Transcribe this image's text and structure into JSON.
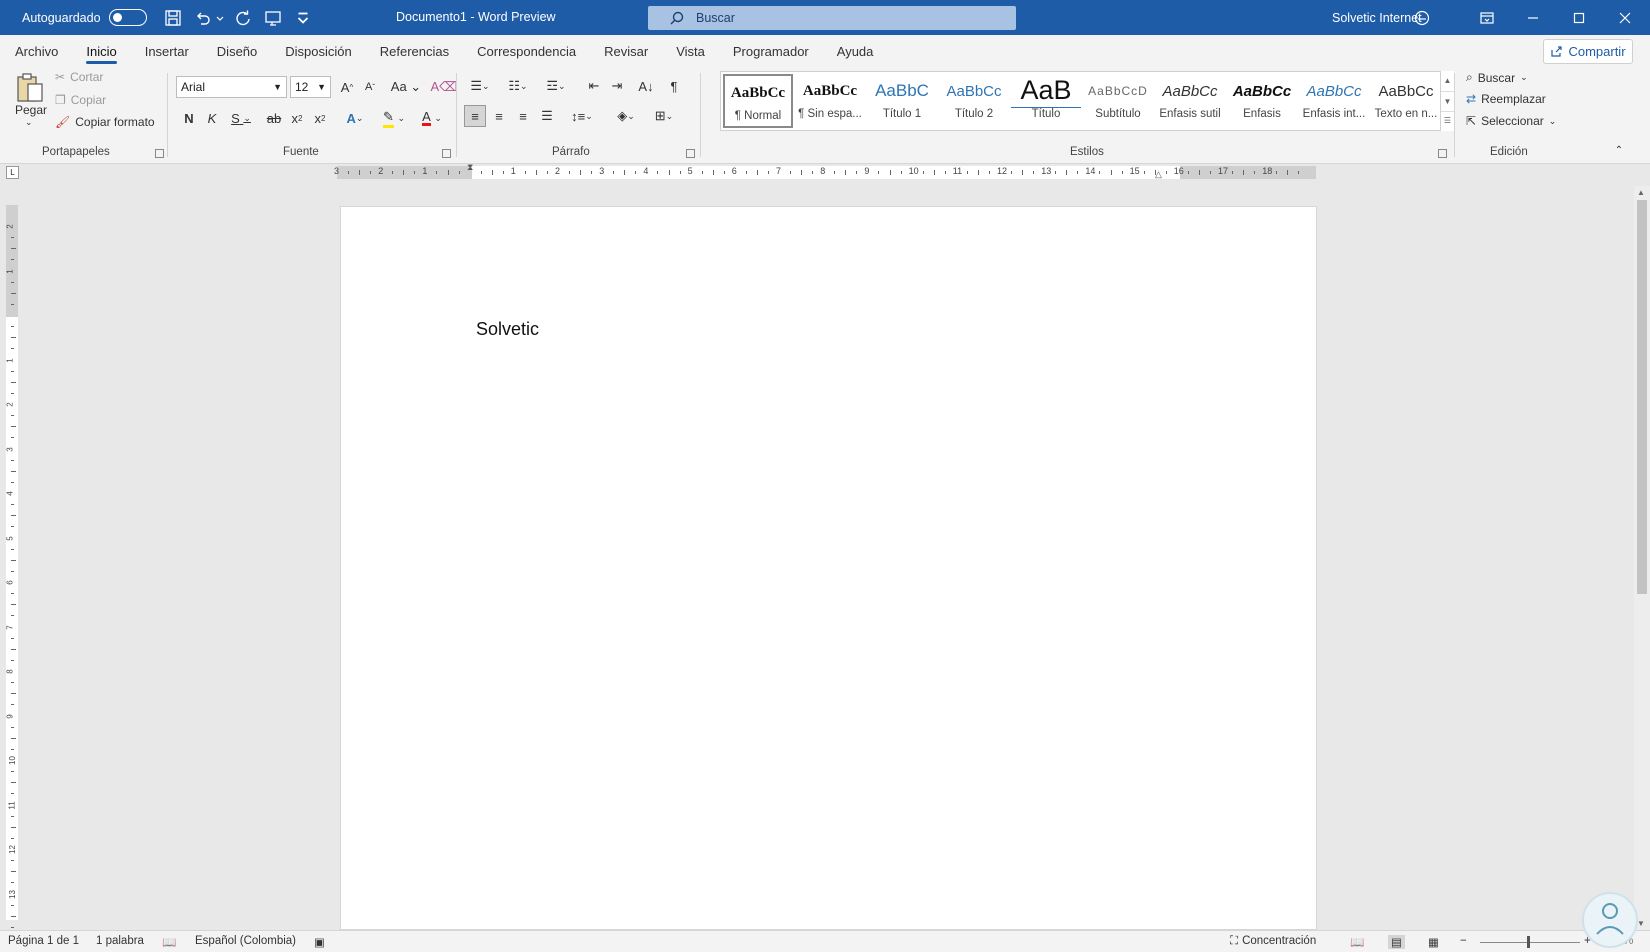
{
  "titlebar": {
    "autosave_label": "Autoguardado",
    "doc_title": "Documento1 - Word Preview",
    "search_placeholder": "Buscar",
    "user_name": "Solvetic Internet"
  },
  "menu": {
    "tabs": [
      "Archivo",
      "Inicio",
      "Insertar",
      "Diseño",
      "Disposición",
      "Referencias",
      "Correspondencia",
      "Revisar",
      "Vista",
      "Programador",
      "Ayuda"
    ],
    "active_tab": "Inicio",
    "share_label": "Compartir"
  },
  "ribbon": {
    "clipboard": {
      "paste": "Pegar",
      "cut": "Cortar",
      "copy": "Copiar",
      "format_painter": "Copiar formato",
      "label": "Portapapeles"
    },
    "font": {
      "name": "Arial",
      "size": "12",
      "bold": "N",
      "italic": "K",
      "underline": "S",
      "label": "Fuente"
    },
    "paragraph": {
      "label": "Párrafo"
    },
    "styles": {
      "label": "Estilos",
      "items": [
        {
          "sample": "AaBbCc",
          "name": "¶ Normal"
        },
        {
          "sample": "AaBbCc",
          "name": "¶ Sin espa..."
        },
        {
          "sample": "AaBbC",
          "name": "Título 1"
        },
        {
          "sample": "AaBbCc",
          "name": "Título 2"
        },
        {
          "sample": "AaB",
          "name": "Título"
        },
        {
          "sample": "AaBbCcD",
          "name": "Subtítulo"
        },
        {
          "sample": "AaBbCc",
          "name": "Énfasis sutil"
        },
        {
          "sample": "AaBbCc",
          "name": "Énfasis"
        },
        {
          "sample": "AaBbCc",
          "name": "Énfasis int..."
        },
        {
          "sample": "AaBbCc",
          "name": "Texto en n..."
        }
      ]
    },
    "editing": {
      "find": "Buscar",
      "replace": "Reemplazar",
      "select": "Seleccionar",
      "label": "Edición"
    }
  },
  "ruler": {
    "numbers": [
      "3",
      "2",
      "1",
      "",
      "1",
      "2",
      "3",
      "4",
      "5",
      "6",
      "7",
      "8",
      "9",
      "10",
      "11",
      "12",
      "13",
      "14",
      "15",
      "16",
      "17",
      "18"
    ]
  },
  "vruler": {
    "numbers": [
      "2",
      "1",
      "",
      "1",
      "2",
      "3",
      "4",
      "5",
      "6",
      "7",
      "8",
      "9",
      "10",
      "11",
      "12",
      "13"
    ]
  },
  "document": {
    "text": "Solvetic"
  },
  "status": {
    "page": "Página 1 de 1",
    "words": "1 palabra",
    "language": "Español (Colombia)",
    "focus": "Concentración",
    "zoom": "120%"
  },
  "colors": {
    "title_bar": "#1f5ca8",
    "accent": "#1f5ca8",
    "heading_blue": "#2e74b5"
  }
}
